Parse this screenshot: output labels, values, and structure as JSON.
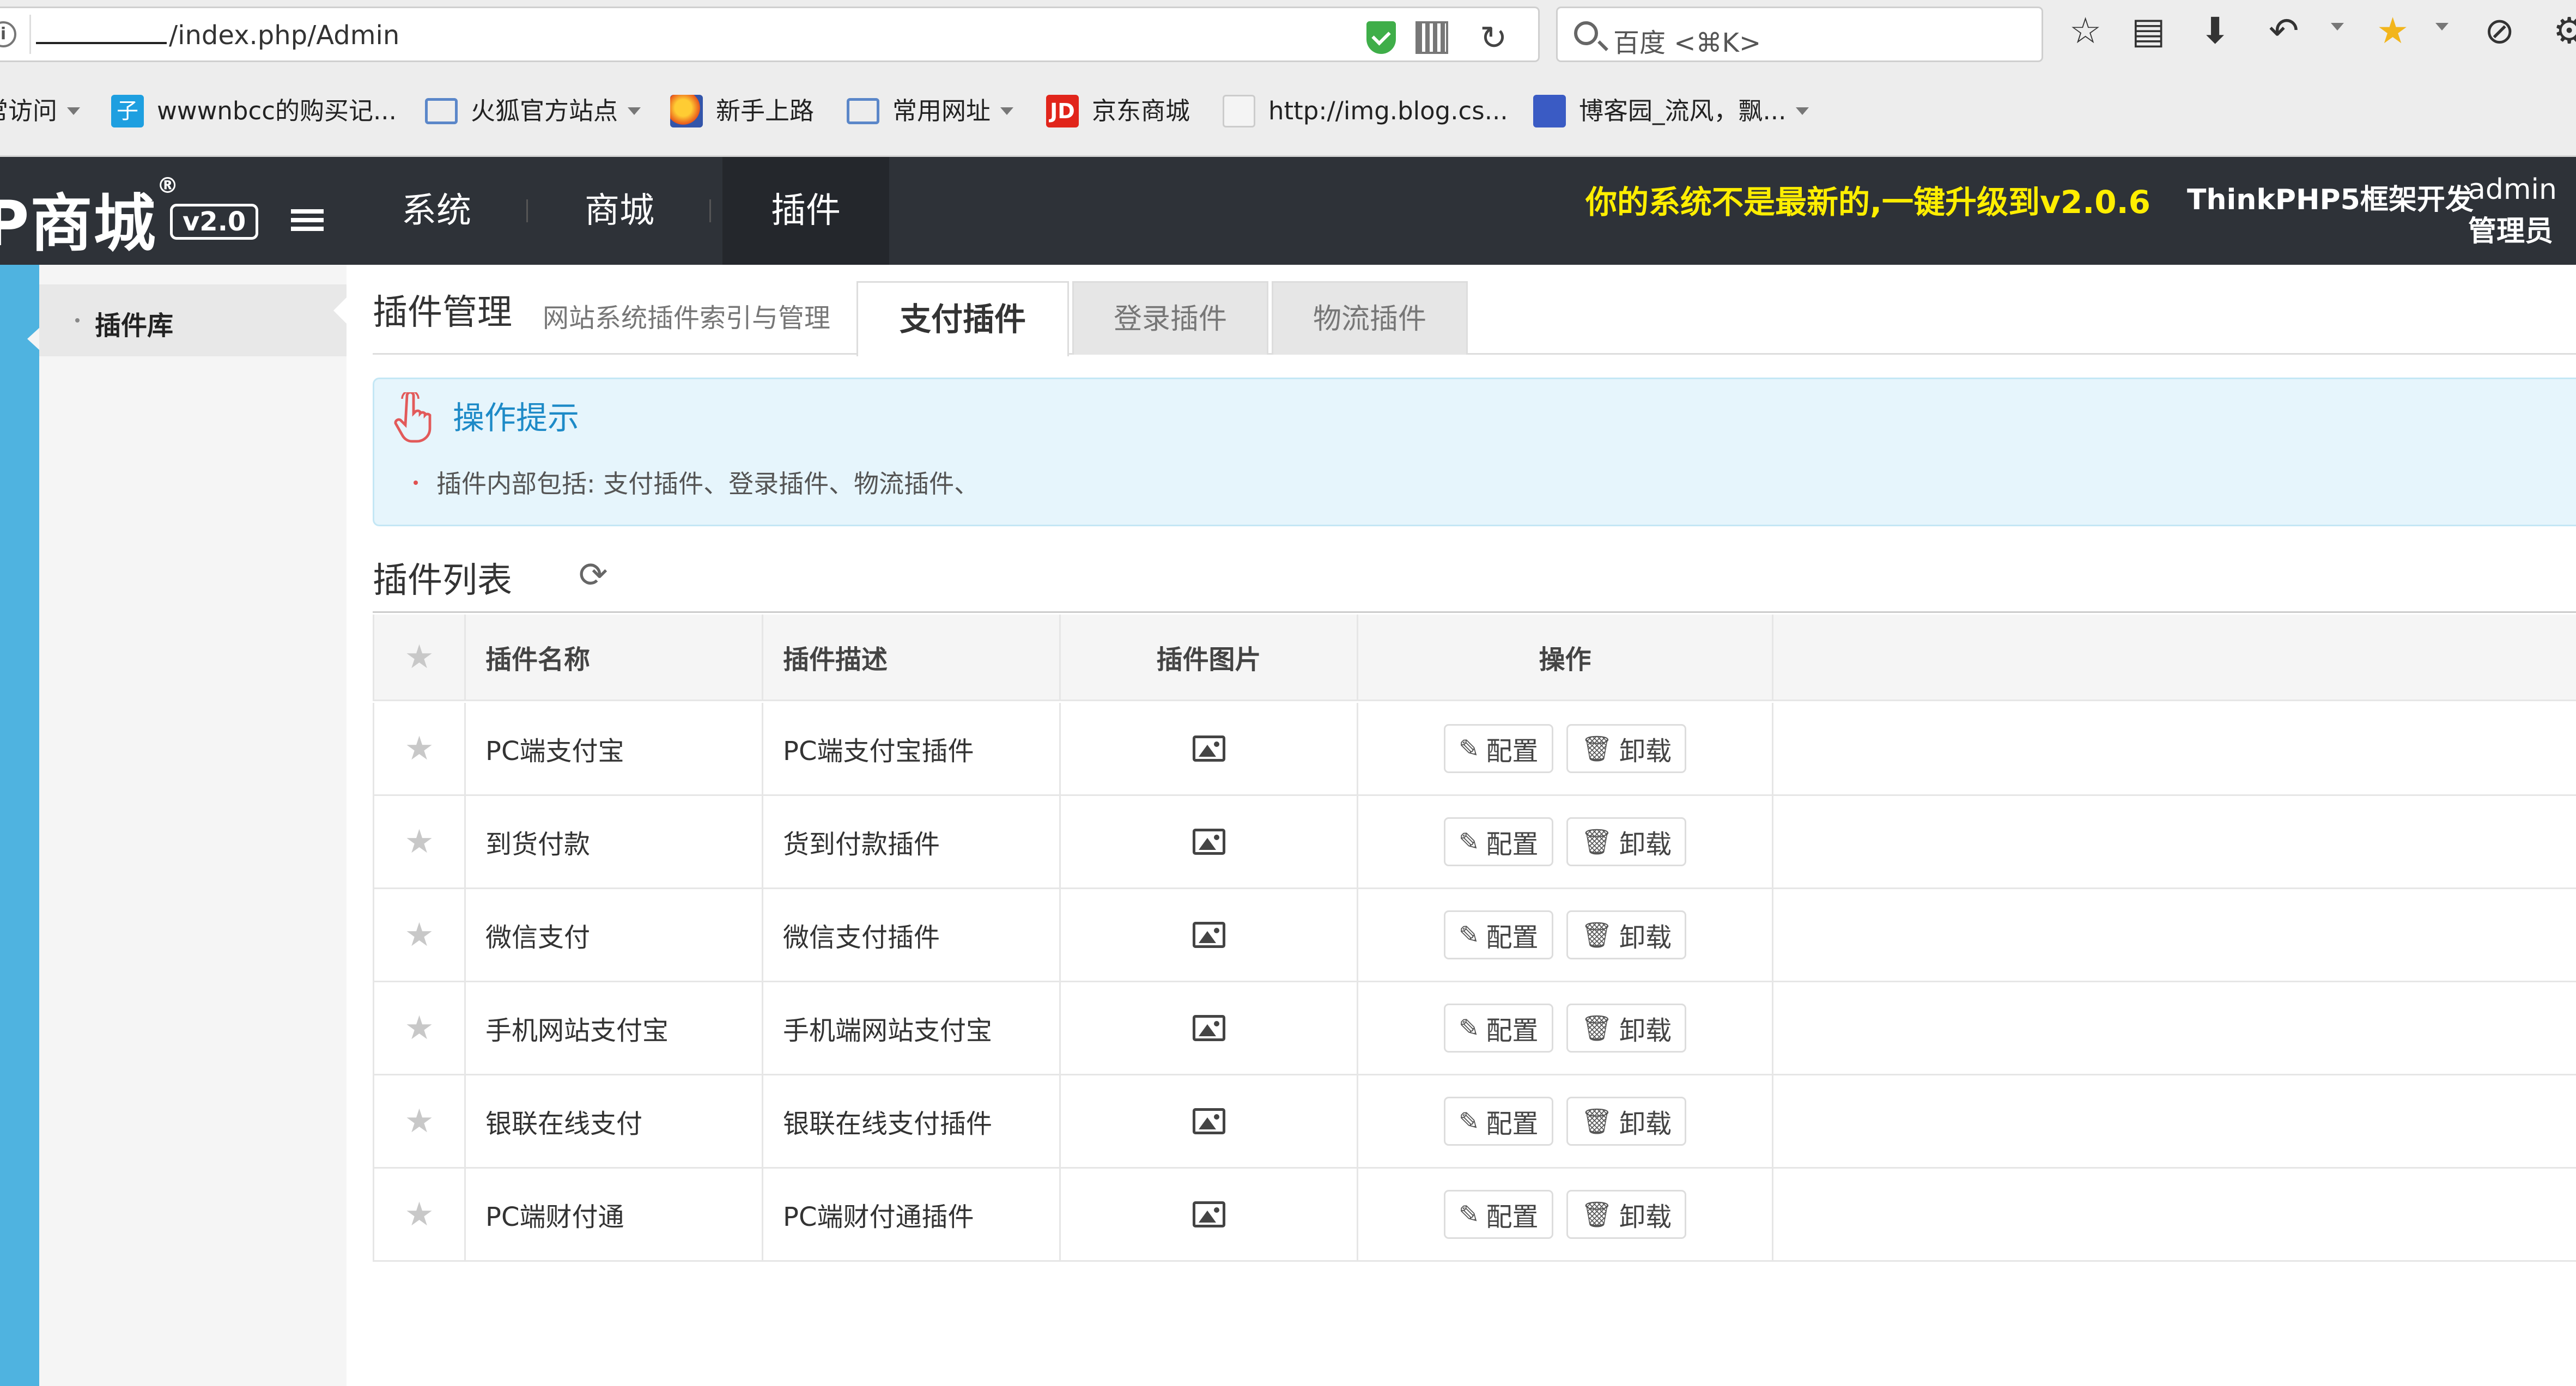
{
  "browser": {
    "url_info": "i",
    "url_text": "/index.php/Admin",
    "search_placeholder": "百度 <⌘K>",
    "reload_glyph": "↻"
  },
  "bookmarks": [
    {
      "label": "常访问",
      "icon": "folder-icon",
      "caret": true
    },
    {
      "label": "wwwnbcc的购买记...",
      "icon": "bookmark-icon"
    },
    {
      "label": "火狐官方站点",
      "icon": "folder-icon",
      "caret": true
    },
    {
      "label": "新手上路",
      "icon": "firefox-icon"
    },
    {
      "label": "常用网址",
      "icon": "folder-icon",
      "caret": true
    },
    {
      "label": "京东商城",
      "icon": "jd-icon",
      "icon_text": "JD"
    },
    {
      "label": "http://img.blog.cs...",
      "icon": "image-icon"
    },
    {
      "label": "博客园_流风，飘...",
      "icon": "rss-icon",
      "caret": true
    }
  ],
  "header": {
    "logo": "P商城",
    "logo_mark": "®",
    "version": "v2.0",
    "nav": [
      "系统",
      "商城",
      "插件"
    ],
    "active_nav": "插件",
    "upgrade_notice": "你的系统不是最新的,一键升级到v2.0.6",
    "framework": "ThinkPHP5框架开发",
    "user_name": "admin",
    "user_role": "管理员"
  },
  "sidebar": {
    "items": [
      {
        "label": "插件库"
      }
    ]
  },
  "main": {
    "title": "插件管理",
    "subtitle": "网站系统插件索引与管理",
    "tabs": [
      {
        "label": "支付插件",
        "active": true
      },
      {
        "label": "登录插件",
        "active": false
      },
      {
        "label": "物流插件",
        "active": false
      }
    ],
    "tip": {
      "title": "操作提示",
      "text": "插件内部包括: 支付插件、登录插件、物流插件、"
    },
    "list_title": "插件列表",
    "table": {
      "columns": [
        "插件名称",
        "插件描述",
        "插件图片",
        "操作"
      ],
      "rows": [
        {
          "name": "PC端支付宝",
          "desc": "PC端支付宝插件"
        },
        {
          "name": "到货付款",
          "desc": "货到付款插件"
        },
        {
          "name": "微信支付",
          "desc": "微信支付插件"
        },
        {
          "name": "手机网站支付宝",
          "desc": "手机端网站支付宝"
        },
        {
          "name": "银联在线支付",
          "desc": "银联在线支付插件"
        },
        {
          "name": "PC端财付通",
          "desc": "PC端财付通插件"
        }
      ],
      "actions": {
        "configure": "配置",
        "uninstall": "卸载"
      }
    }
  },
  "colors": {
    "header_bg": "#2e3238",
    "rail_blue": "#4fb3e0",
    "upgrade_yellow": "#ffee00",
    "tip_bg": "#e6f5fc",
    "tip_title": "#1d8ac7"
  }
}
